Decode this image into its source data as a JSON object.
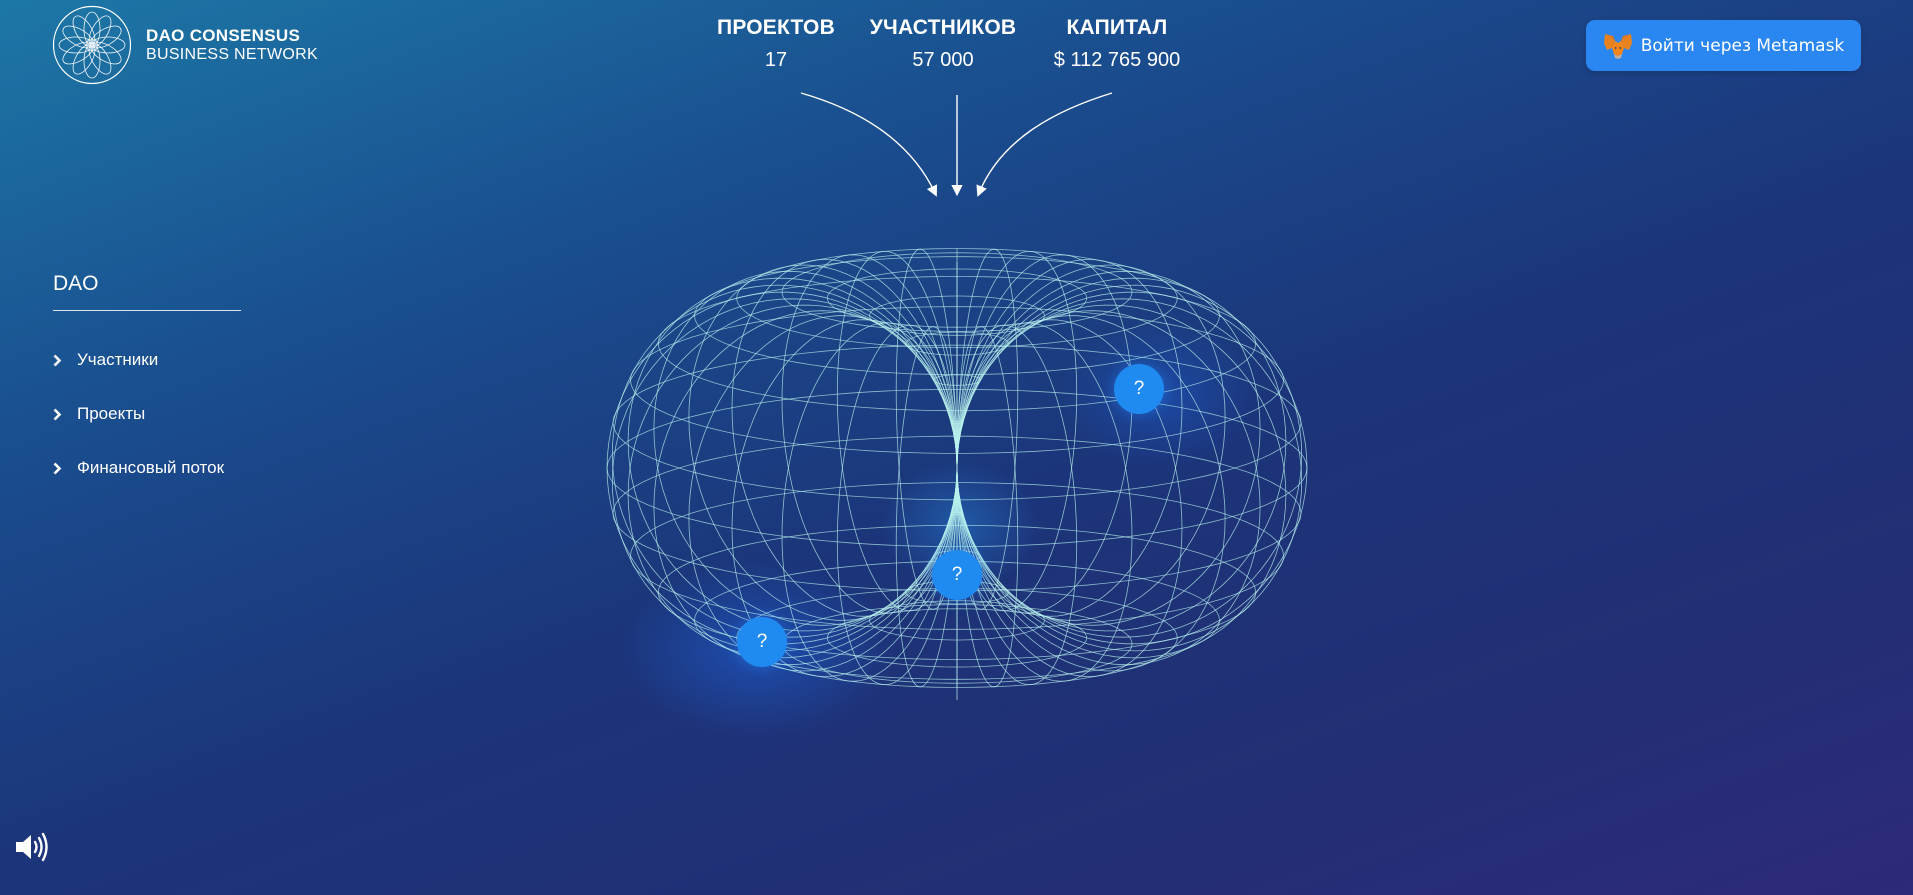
{
  "brand": {
    "line1": "DAO CONSENSUS",
    "line2": "BUSINESS NETWORK"
  },
  "stats": [
    {
      "label": "ПРОЕКТОВ",
      "value": "17"
    },
    {
      "label": "УЧАСТНИКОВ",
      "value": "57 000"
    },
    {
      "label": "КАПИТАЛ",
      "value": "$ 112 765 900"
    }
  ],
  "login": {
    "label": "Войти через Metamask",
    "icon": "metamask-fox-icon"
  },
  "nav": {
    "title": "DAO",
    "items": [
      {
        "label": "Участники"
      },
      {
        "label": "Проекты"
      },
      {
        "label": "Финансовый поток"
      }
    ]
  },
  "hotspots": [
    {
      "label": "?"
    },
    {
      "label": "?"
    },
    {
      "label": "?"
    }
  ],
  "colors": {
    "accent": "#2a86f0",
    "wireframe": "#b8f2ee",
    "background_top": "#1c77a6",
    "background_bottom": "#2d2a78"
  },
  "icons": {
    "sound": "speaker-icon",
    "nav_chevron": "chevron-right-icon",
    "logo": "flower-of-life-logo"
  }
}
